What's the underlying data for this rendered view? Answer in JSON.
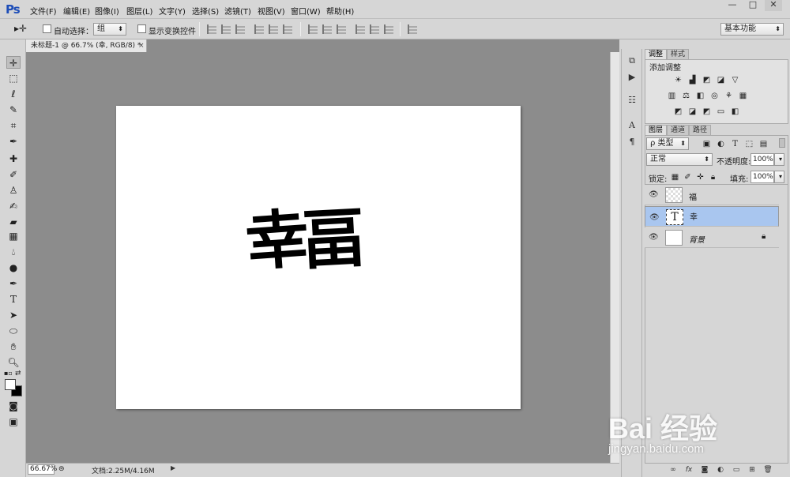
{
  "app": {
    "logo": "Ps"
  },
  "menu": [
    "文件(F)",
    "编辑(E)",
    "图像(I)",
    "图层(L)",
    "文字(Y)",
    "选择(S)",
    "滤镜(T)",
    "视图(V)",
    "窗口(W)",
    "帮助(H)"
  ],
  "window_controls": [
    "—",
    "□",
    "✕"
  ],
  "options": {
    "auto_select_label": "自动选择：",
    "auto_select_value": "组",
    "transform_label": "显示变换控件",
    "workspace": "基本功能"
  },
  "document": {
    "tab_title": "未标题-1 @ 66.7% (幸, RGB/8) *",
    "tab_close": "×",
    "zoom": "66.67%",
    "doc_info": "文档:2.25M/4.16M",
    "canvas_text_left": "幸",
    "canvas_text_right": "畐"
  },
  "panels": {
    "tabs_top": [
      "调整",
      "样式"
    ],
    "adjust_title": "添加调整",
    "tabs_layers": [
      "图层",
      "通道",
      "路径"
    ],
    "kind_filter": "ρ 类型",
    "blend_mode": "正常",
    "opacity_label": "不透明度:",
    "opacity_value": "100%",
    "lock_label": "锁定:",
    "fill_label": "填充:",
    "fill_value": "100%",
    "layers": [
      {
        "name": "福",
        "type": "pixel",
        "selected": false
      },
      {
        "name": "幸",
        "type": "text",
        "selected": true
      },
      {
        "name": "背景",
        "type": "background",
        "selected": false
      }
    ]
  },
  "watermark": {
    "brand": "Bai 经验",
    "url": "jingyan.baidu.com"
  },
  "colors": {
    "selected_layer": "#a9c6ef",
    "canvas_bg": "#8c8c8c",
    "logo": "#1e4eb8"
  }
}
